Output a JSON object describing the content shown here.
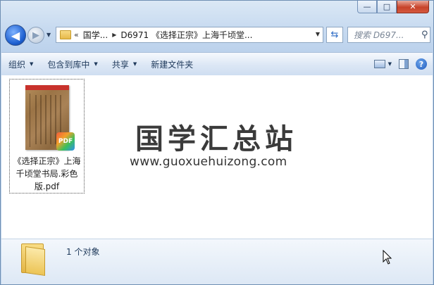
{
  "window": {
    "minimize_glyph": "—",
    "maximize_glyph": "□",
    "close_glyph": "✕"
  },
  "address": {
    "overflow_chevron": "«",
    "crumb_1": "国学...",
    "crumb_2": "D6971 《选择正宗》上海千顷堂..."
  },
  "search": {
    "placeholder": "搜索 D697..."
  },
  "toolbar": {
    "organize": "组织",
    "include_in_library": "包含到库中",
    "share": "共享",
    "new_folder": "新建文件夹"
  },
  "files": [
    {
      "name": "《选择正宗》上海千顷堂书局.彩色版.pdf",
      "badge": "PDF",
      "icon": "pdf-book-thumbnail"
    }
  ],
  "watermark": {
    "title": "国学汇总站",
    "url": "www.guoxuehuizong.com"
  },
  "status": {
    "count_text": "1 个对象"
  },
  "colors": {
    "frame": "#c7daf0",
    "toolbar": "#dce7f5",
    "close_button": "#c7432a",
    "accent": "#1d5fd0"
  }
}
